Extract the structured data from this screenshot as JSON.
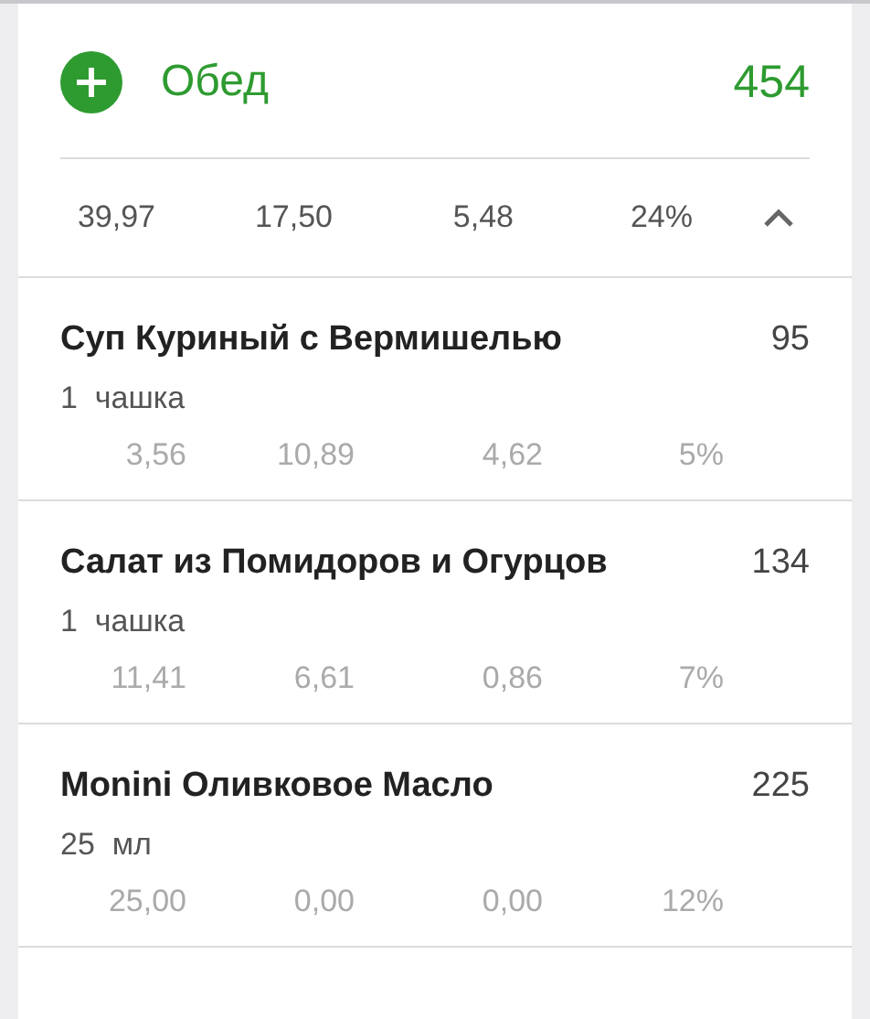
{
  "meal": {
    "title": "Обед",
    "calories": "454",
    "expanded": true
  },
  "totals": [
    "39,97",
    "17,50",
    "5,48",
    "24%"
  ],
  "items": [
    {
      "name": "Суп Куриный с Вермишелью",
      "calories": "95",
      "portion": "1  чашка",
      "macros": [
        "3,56",
        "10,89",
        "4,62",
        "5%"
      ]
    },
    {
      "name": "Салат из Помидоров и Огурцов",
      "calories": "134",
      "portion": "1  чашка",
      "macros": [
        "11,41",
        "6,61",
        "0,86",
        "7%"
      ]
    },
    {
      "name": "Monini Оливковое Масло",
      "calories": "225",
      "portion": "25  мл",
      "macros": [
        "25,00",
        "0,00",
        "0,00",
        "12%"
      ]
    }
  ]
}
